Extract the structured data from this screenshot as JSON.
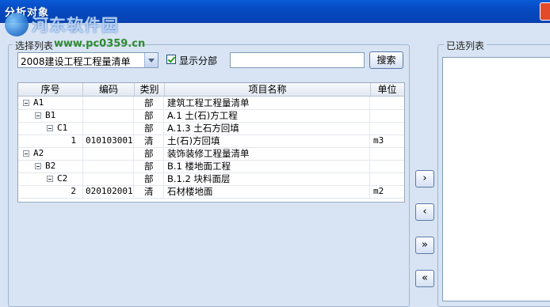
{
  "window": {
    "title": "分析对象"
  },
  "watermark": {
    "site_name": "河东软件园",
    "url": "www.pc0359.cn"
  },
  "left_group": {
    "label": "选择列表"
  },
  "project_select": {
    "value": "2008建设工程工程量清单"
  },
  "show_division": {
    "label": "显示分部",
    "checked": true
  },
  "search": {
    "value": "",
    "button_label": "搜索"
  },
  "grid": {
    "columns": [
      "序号",
      "编码",
      "类别",
      "项目名称",
      "单位"
    ],
    "rows": [
      {
        "seq": "A1",
        "code": "",
        "type": "部",
        "name": "建筑工程工程量清单",
        "unit": "",
        "level": 0,
        "expandable": true
      },
      {
        "seq": "B1",
        "code": "",
        "type": "部",
        "name": "A.1 土(石)方工程",
        "unit": "",
        "level": 1,
        "expandable": true
      },
      {
        "seq": "C1",
        "code": "",
        "type": "部",
        "name": "A.1.3 土石方回填",
        "unit": "",
        "level": 2,
        "expandable": true
      },
      {
        "seq": "1",
        "code": "010103001",
        "type": "清",
        "name": "土(石)方回填",
        "unit": "m3",
        "level": 3,
        "expandable": false
      },
      {
        "seq": "A2",
        "code": "",
        "type": "部",
        "name": "装饰装修工程量清单",
        "unit": "",
        "level": 0,
        "expandable": true
      },
      {
        "seq": "B2",
        "code": "",
        "type": "部",
        "name": "B.1 楼地面工程",
        "unit": "",
        "level": 1,
        "expandable": true
      },
      {
        "seq": "C2",
        "code": "",
        "type": "部",
        "name": "B.1.2 块料面层",
        "unit": "",
        "level": 2,
        "expandable": true
      },
      {
        "seq": "2",
        "code": "020102001",
        "type": "清",
        "name": "石材楼地面",
        "unit": "m2",
        "level": 3,
        "expandable": false
      }
    ]
  },
  "transfer_buttons": {
    "add_one": "›",
    "remove_one": "‹",
    "add_all": "»",
    "remove_all": "«"
  },
  "right_group": {
    "label": "已选列表"
  },
  "colors": {
    "titlebar": "#0649c0",
    "panel": "#d8e4f3",
    "check": "#21a121"
  }
}
